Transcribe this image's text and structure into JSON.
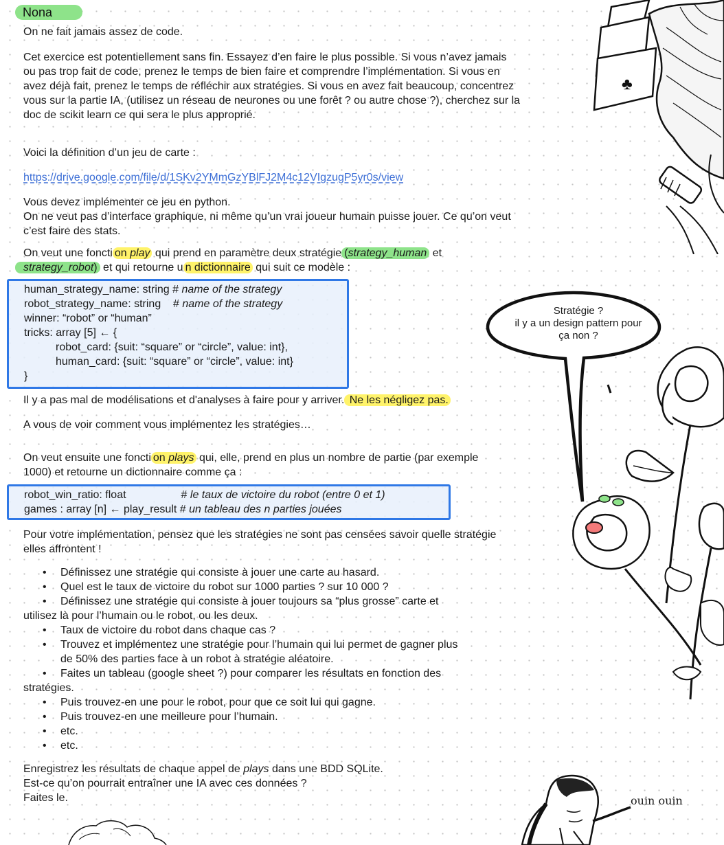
{
  "page": {
    "tag": "Nona"
  },
  "intro": {
    "line1": "On ne fait jamais assez de code.",
    "para2": "Cet exercice est potentiellement sans fin. Essayez d’en faire le plus possible. Si vous n’avez jamais ou pas trop fait de code, prenez le temps de bien faire et comprendre l’implémentation. Si vous en avez déjà fait, prenez le temps de réfléchir aux stratégies. Si vous en avez fait beaucoup, concentrez vous sur la partie IA, (utilisez un réseau de neurones ou une forêt ? ou autre chose ?), cherchez sur la doc de scikit learn ce qui sera le plus approprié.",
    "definition": "Voici la définition d’un jeu de carte :",
    "link": "https://drive.google.com/file/d/1SKv2YMmGzYBlFJ2M4c12VIgzugP5yr0s/view",
    "implement": "Vous devez implémenter ce jeu en python.",
    "no_ui": "On ne veut pas d’interface graphique, ni même qu’un vrai joueur humain puisse jouer. Ce qu’on veut c’est faire des stats."
  },
  "play_para": {
    "t1": "On veut une foncti",
    "t2": "on ",
    "play_word": "play",
    "t3": " qui prend en paramètre deux stratégie",
    "paren_open": "(",
    "strategy_human": "strategy_human",
    "et": " et",
    "strategy_robot": "strategy_robot",
    "paren_close": ")",
    "t4": " et qui retourne u",
    "n_dict": "n dictionnaire",
    "t5": " qui suit ce modèle :"
  },
  "model1": {
    "l1_a": "human_strategy_name: string # ",
    "l1_b": "name of the strategy",
    "l2_a": "robot_strategy_name: string    # ",
    "l2_b": "name of the strategy",
    "l3": "winner: “robot” or “human”",
    "l4": "tricks: array [5] ← {",
    "l5": "robot_card: {suit: “square” or “circle”, value: int},",
    "l6": "human_card: {suit: “square” or “circle”, value: int}",
    "l7": "}"
  },
  "analysis": {
    "t1": "Il y a pas mal de modélisations et d'analyses à faire pour y arriver.",
    "hl": " Ne les négligez pas. ",
    "strategies": "A vous de voir comment vous implémentez les stratégies…"
  },
  "plays_para": {
    "t1": "On veut ensuite une foncti",
    "t2": "on ",
    "plays_word": "plays",
    "t3": " qui, elle, prend en plus un nombre de partie (par exemple 1000) et retourne un dictionnaire comme ça :"
  },
  "model2": {
    "l1_a": "robot_win_ratio: float                  # ",
    "l1_b": "le taux de victoire du robot (entre 0 et 1)",
    "l2_a": "games : array [n] ← play_result # ",
    "l2_b": "un tableau des n parties jouées"
  },
  "note": "Pour votre implémentation, pensez que les stratégies ne sont pas censées savoir quelle stratégie elles affrontent !",
  "bullets": {
    "b1": "Définissez une stratégie qui consiste à jouer une carte au hasard.",
    "b2": "Quel est le taux de victoire du robot sur 1000 parties ? sur 10 000 ?",
    "b3a": "Définissez une stratégie qui consiste à jouer toujours sa “plus grosse” carte et",
    "b3b": "utilisez là pour l’humain ou le robot, ou les deux.",
    "b4": "Taux de victoire du robot dans chaque cas ?",
    "b5a": "Trouvez et implémentez une stratégie pour l’humain qui lui permet de gagner plus",
    "b5b": "de 50% des parties face à un robot à stratégie aléatoire.",
    "b6a": "Faites un tableau (google sheet ?) pour comparer les résultats en fonction des",
    "b6b": "stratégies.",
    "b7": "Puis trouvez-en une pour le robot, pour que ce soit lui qui gagne.",
    "b8": "Puis trouvez-en une meilleure pour l’humain.",
    "b9": "etc.",
    "b10": "etc."
  },
  "outro": {
    "l1_a": "Enregistrez les résultats de chaque appel de ",
    "l1_b": "plays",
    "l1_c": " dans une BDD SQLite.",
    "l2": "Est-ce qu’on pourrait entraîner une IA avec ces données ?",
    "l3": "Faites le."
  },
  "bubble": {
    "l1": "Stratégie ?",
    "l2": "il y a un design pattern pour",
    "l3": "ça non ?"
  },
  "caption": "ouin ouin",
  "colors": {
    "highlight_yellow": "#fff36a",
    "highlight_green": "#8ee38a",
    "box_border": "#2f78e6",
    "link": "#3d6fd6"
  }
}
